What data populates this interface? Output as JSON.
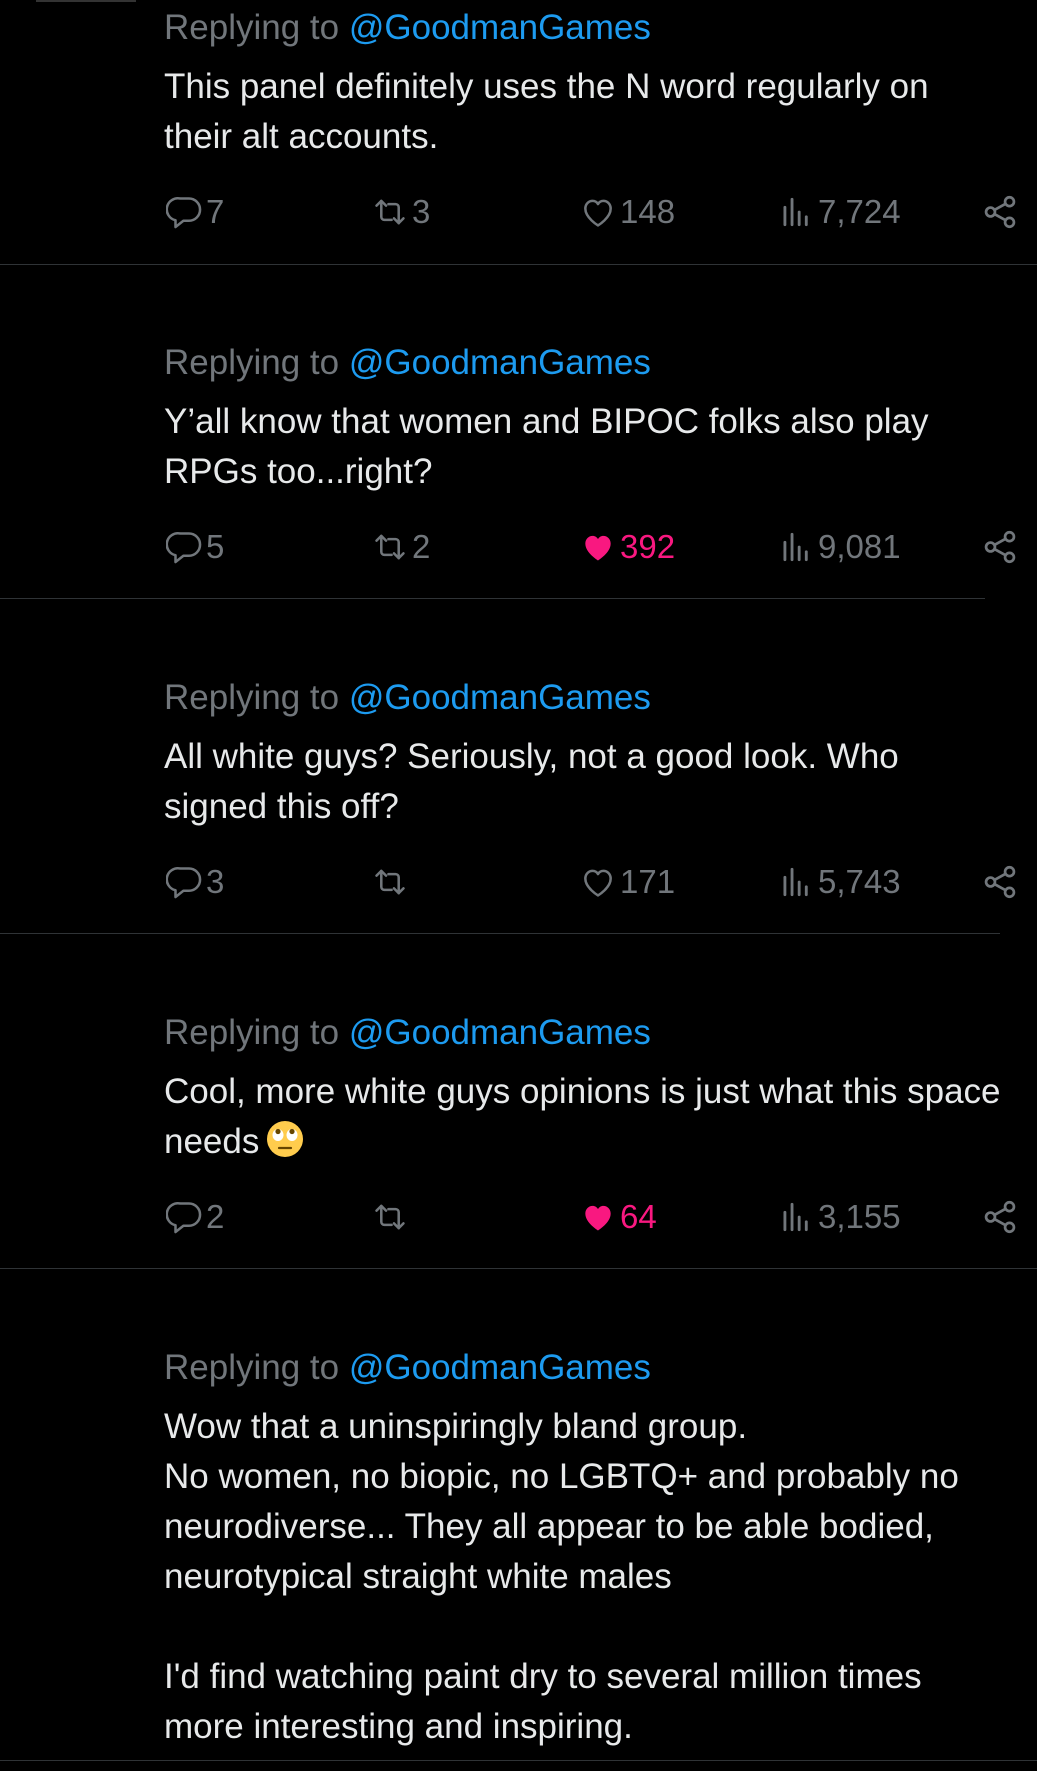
{
  "replies": [
    {
      "replying_prefix": "Replying to",
      "replying_handle": "@GoodmanGames",
      "text": "This panel definitely uses the N word regularly on their alt accounts.",
      "reply_count": "7",
      "repost_count": "3",
      "like_count": "148",
      "liked": false,
      "view_count": "7,724"
    },
    {
      "replying_prefix": "Replying to",
      "replying_handle": "@GoodmanGames",
      "text": "Y’all know that women and BIPOC folks also play RPGs too...right?",
      "reply_count": "5",
      "repost_count": "2",
      "like_count": "392",
      "liked": true,
      "view_count": "9,081"
    },
    {
      "replying_prefix": "Replying to",
      "replying_handle": "@GoodmanGames",
      "text": "All white guys? Seriously, not a good look. Who signed this off?",
      "reply_count": "3",
      "repost_count": "",
      "like_count": "171",
      "liked": false,
      "view_count": "5,743"
    },
    {
      "replying_prefix": "Replying to",
      "replying_handle": "@GoodmanGames",
      "text": "Cool, more white guys opinions is just what this space needs",
      "emoji": "face-with-rolling-eyes-icon",
      "reply_count": "2",
      "repost_count": "",
      "like_count": "64",
      "liked": true,
      "view_count": "3,155"
    },
    {
      "replying_prefix": "Replying to",
      "replying_handle": "@GoodmanGames",
      "text": "Wow that a uninspiringly bland group.\nNo women, no biopic, no LGBTQ+ and probably no neurodiverse... They all appear to be able bodied, neurotypical straight white males\n\nI'd find watching paint dry to several million times more interesting and inspiring."
    }
  ],
  "icons": {
    "reply": "reply-icon",
    "repost": "repost-icon",
    "like": "heart-icon",
    "views": "views-icon",
    "share": "share-icon"
  },
  "colors": {
    "background": "#000000",
    "text": "#e7e9ea",
    "muted": "#71767b",
    "link": "#1d9bf0",
    "like_active": "#f91880"
  }
}
